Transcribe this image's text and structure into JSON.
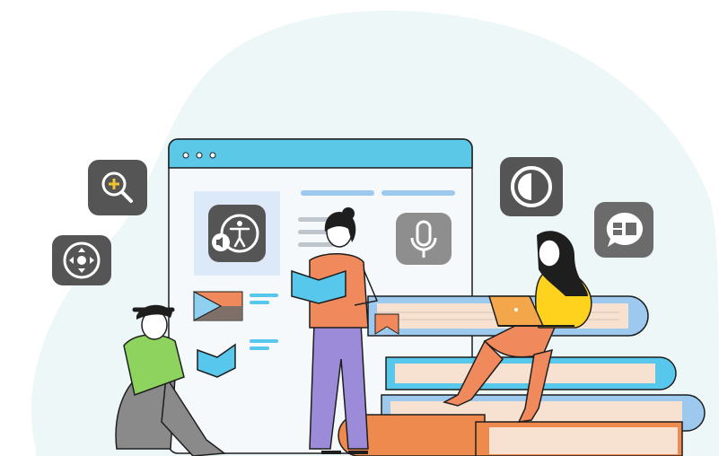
{
  "illustration": {
    "theme": "accessibility-reading",
    "colors": {
      "blob": "#eef7f7",
      "window_bar": "#5bc8e8",
      "window_body": "#f6f9fb",
      "panel": "#dbe9f8",
      "tile": "#555555",
      "tile_icon": "#ffffff",
      "book_blue": "#9ec9ef",
      "book_cyan": "#58c7ec",
      "book_orange": "#ef8a4e",
      "book_cream": "#f7e2d2",
      "accent_orange": "#f08a5d",
      "yellow_shirt": "#ffd21e",
      "green_shirt": "#8fd35f",
      "lavender_pants": "#9b8bd8",
      "outline": "#1e1e1e"
    },
    "window_dots": [
      "dot",
      "dot",
      "dot"
    ],
    "tiles": [
      {
        "name": "zoom-in-icon"
      },
      {
        "name": "navigation-dpad-icon"
      },
      {
        "name": "accessibility-audio-icon"
      },
      {
        "name": "microphone-icon"
      },
      {
        "name": "contrast-icon"
      },
      {
        "name": "speech-bubble-icon"
      }
    ],
    "people": [
      {
        "name": "person-sitting-reading"
      },
      {
        "name": "person-standing-reading"
      },
      {
        "name": "person-with-laptop"
      }
    ]
  }
}
